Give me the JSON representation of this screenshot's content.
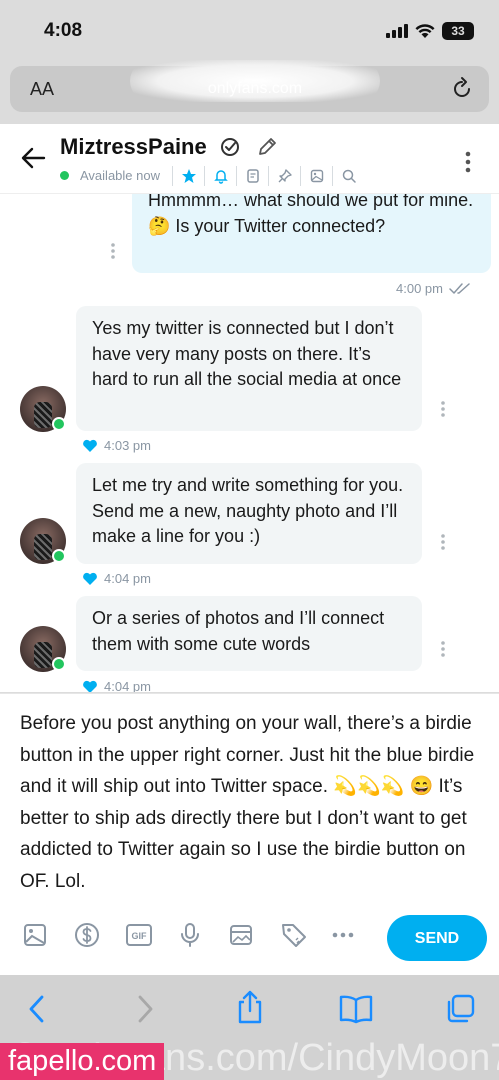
{
  "status_bar": {
    "time": "4:08",
    "battery": "33"
  },
  "url_bar": {
    "aa_label": "AA",
    "url_text": "onlyfans.com"
  },
  "chat": {
    "name": "MiztressPaine",
    "status": "Available now"
  },
  "messages": [
    {
      "direction": "out",
      "text": "Hmmmm… what should we put for mine. 🤔 Is your Twitter connected?",
      "time": "4:00 pm"
    },
    {
      "direction": "in",
      "text": "Yes my twitter is connected but I don’t have very many posts on there. It’s hard to run all the social media at once",
      "time": "4:03 pm"
    },
    {
      "direction": "in",
      "text": "Let me try and write something for you. Send me a new, naughty photo and I’ll make a line for you :)",
      "time": "4:04 pm"
    },
    {
      "direction": "in",
      "text": "Or a series of photos and I’ll connect them with some cute words",
      "time": "4:04 pm"
    }
  ],
  "compose": {
    "text": "Before you post anything on your wall, there’s a birdie button in the upper right corner. Just hit the blue birdie and it will ship out into Twitter space. 💫💫💫 😄 It’s better to ship ads directly there but I don’t want to get addicted to Twitter again so I use the birdie button on OF. Lol.",
    "send_label": "SEND",
    "gif_label": "GIF"
  },
  "watermark": {
    "site": "fapello.com",
    "overlay": "@OnlyFans.com/CindyMoon7"
  },
  "colors": {
    "accent": "#00aff0",
    "online": "#22c55e",
    "watermark_bg": "#e8336d"
  }
}
